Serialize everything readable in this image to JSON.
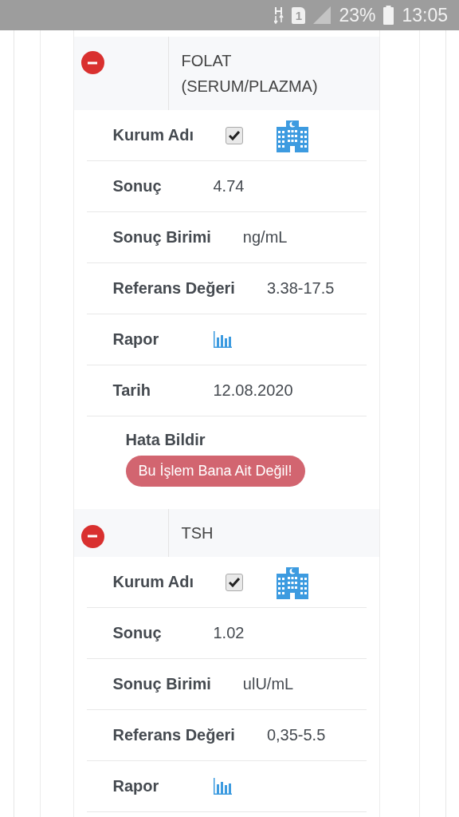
{
  "status_bar": {
    "sim": "1",
    "battery": "23%",
    "time": "13:05"
  },
  "tests": [
    {
      "name": "FOLAT\n(SERUM/PLAZMA)",
      "expanded": true,
      "rows": [
        {
          "kind": "institution",
          "label": "Kurum Adı",
          "checked": true
        },
        {
          "kind": "text",
          "label": "Sonuç",
          "value": "4.74"
        },
        {
          "kind": "text",
          "label": "Sonuç Birimi",
          "value": "ng/mL"
        },
        {
          "kind": "text",
          "label": "Referans Değeri",
          "value": "3.38-17.5"
        },
        {
          "kind": "report",
          "label": "Rapor"
        },
        {
          "kind": "text",
          "label": "Tarih",
          "value": "12.08.2020"
        }
      ],
      "report_error": {
        "label": "Hata Bildir",
        "button": "Bu İşlem Bana Ait Değil!"
      }
    },
    {
      "name": "TSH",
      "expanded": true,
      "rows": [
        {
          "kind": "institution",
          "label": "Kurum Adı",
          "checked": true
        },
        {
          "kind": "text",
          "label": "Sonuç",
          "value": "1.02"
        },
        {
          "kind": "text",
          "label": "Sonuç Birimi",
          "value": "ulU/mL"
        },
        {
          "kind": "text",
          "label": "Referans Değeri",
          "value": "0,35-5.5"
        },
        {
          "kind": "report",
          "label": "Rapor"
        }
      ]
    }
  ]
}
